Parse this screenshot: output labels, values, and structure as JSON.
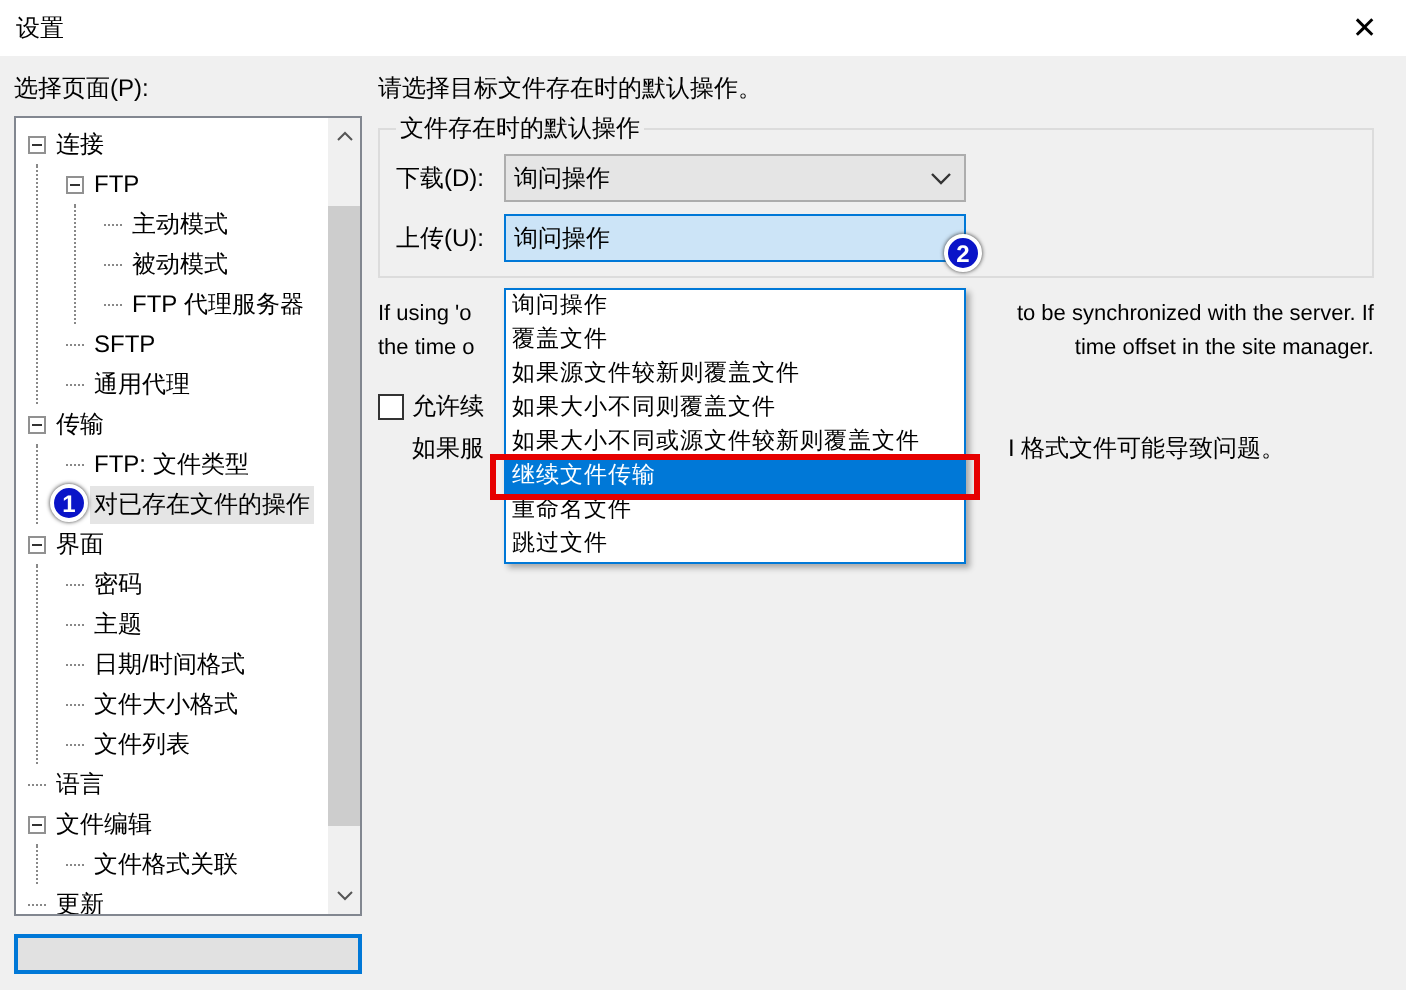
{
  "window": {
    "title": "设置",
    "close": "✕"
  },
  "sidebar": {
    "label": "选择页面(P):",
    "items": [
      {
        "label": "连接",
        "expanded": true,
        "selected": false,
        "children": [
          {
            "label": "FTP",
            "expanded": true,
            "selected": false,
            "children": [
              {
                "label": "主动模式",
                "selected": false
              },
              {
                "label": "被动模式",
                "selected": false
              },
              {
                "label": "FTP 代理服务器",
                "selected": false
              }
            ]
          },
          {
            "label": "SFTP",
            "selected": false
          },
          {
            "label": "通用代理",
            "selected": false
          }
        ]
      },
      {
        "label": "传输",
        "expanded": true,
        "selected": false,
        "children": [
          {
            "label": "FTP: 文件类型",
            "selected": false
          },
          {
            "label": "对已存在文件的操作",
            "selected": true,
            "badge": "1"
          }
        ]
      },
      {
        "label": "界面",
        "expanded": true,
        "selected": false,
        "children": [
          {
            "label": "密码",
            "selected": false
          },
          {
            "label": "主题",
            "selected": false
          },
          {
            "label": "日期/时间格式",
            "selected": false
          },
          {
            "label": "文件大小格式",
            "selected": false
          },
          {
            "label": "文件列表",
            "selected": false
          }
        ]
      },
      {
        "label": "语言",
        "selected": false
      },
      {
        "label": "文件编辑",
        "expanded": true,
        "selected": false,
        "children": [
          {
            "label": "文件格式关联",
            "selected": false
          }
        ]
      },
      {
        "label": "更新",
        "selected": false
      }
    ]
  },
  "content": {
    "intro": "请选择目标文件存在时的默认操作。",
    "group_title": "文件存在时的默认操作",
    "download": {
      "label": "下载(D):",
      "value": "询问操作"
    },
    "upload": {
      "label": "上传(U):",
      "value": "询问操作",
      "badge": "2",
      "open": true
    },
    "options": [
      {
        "label": "询问操作",
        "selected": false
      },
      {
        "label": "覆盖文件",
        "selected": false
      },
      {
        "label": "如果源文件较新则覆盖文件",
        "selected": false
      },
      {
        "label": "如果大小不同则覆盖文件",
        "selected": false
      },
      {
        "label": "如果大小不同或源文件较新则覆盖文件",
        "selected": false
      },
      {
        "label": "继续文件传输",
        "selected": true
      },
      {
        "label": "重命名文件",
        "selected": false
      },
      {
        "label": "跳过文件",
        "selected": false
      }
    ],
    "note_lines": [
      {
        "left": "If using 'o",
        "right": "to be synchronized with the server. If"
      },
      {
        "left": "the time o",
        "right": "time offset in the site manager."
      }
    ],
    "checkbox": {
      "label": "允许续",
      "checked": false
    },
    "hint": {
      "left": "如果服",
      "right": "I 格式文件可能导致问题。"
    }
  }
}
